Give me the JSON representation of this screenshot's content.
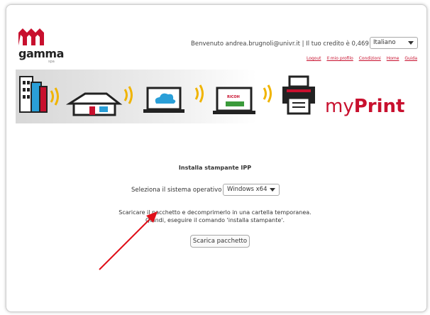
{
  "header": {
    "logo_text": "gamma",
    "logo_sub": "spa",
    "welcome_text": "Benvenuto andrea.brugnoli@univr.it | Il tuo credito è 0,469 €",
    "language_selected": "Italiano",
    "links": [
      "Logout",
      "Il mio profilo",
      "Condizioni",
      "Home",
      "Guida"
    ]
  },
  "banner": {
    "brand_prefix": "my",
    "brand_bold": "Print",
    "laptop2_label": "RICOH"
  },
  "main": {
    "title": "Installa stampante IPP",
    "os_label": "Seleziona il sistema operativo",
    "os_selected": "Windows x64",
    "instruction_line1": "Scaricare il pacchetto e decomprimerlo in una cartella temporanea.",
    "instruction_line2": "Quindi, eseguire il comando 'installa stampante'.",
    "download_button": "Scarica pacchetto"
  },
  "colors": {
    "brand_red": "#c8102e",
    "wave_yellow": "#f0b400",
    "cloud_blue": "#2a9fd8"
  }
}
